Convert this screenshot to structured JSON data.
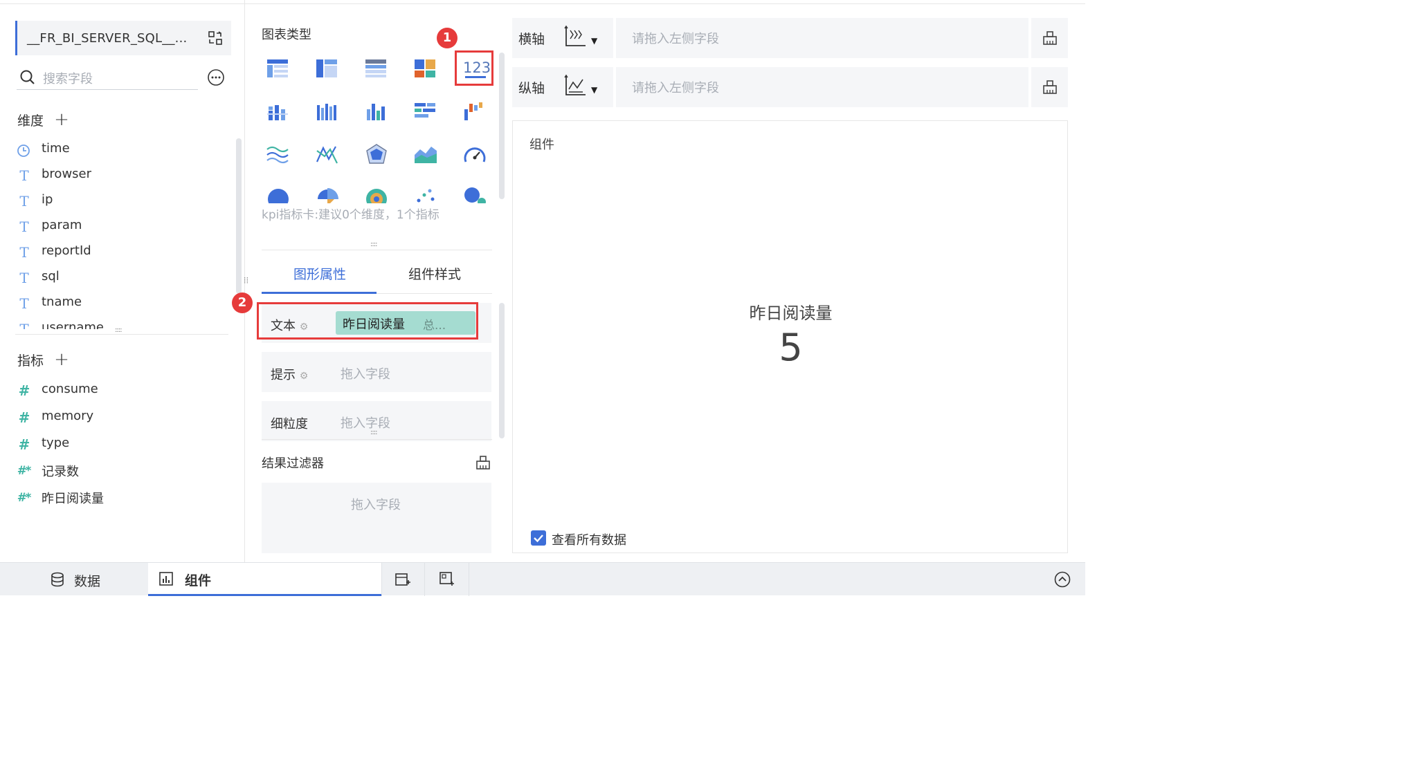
{
  "dataset": {
    "name": "__FR_BI_SERVER_SQL__..."
  },
  "search": {
    "placeholder": "搜索字段"
  },
  "dimensions": {
    "title": "维度",
    "items": [
      {
        "name": "time",
        "type": "date"
      },
      {
        "name": "browser",
        "type": "text"
      },
      {
        "name": "ip",
        "type": "text"
      },
      {
        "name": "param",
        "type": "text"
      },
      {
        "name": "reportId",
        "type": "text"
      },
      {
        "name": "sql",
        "type": "text"
      },
      {
        "name": "tname",
        "type": "text"
      },
      {
        "name": "username",
        "type": "text"
      }
    ]
  },
  "measures": {
    "title": "指标",
    "items": [
      {
        "name": "consume",
        "icon": "#"
      },
      {
        "name": "memory",
        "icon": "#"
      },
      {
        "name": "type",
        "icon": "#"
      },
      {
        "name": "记录数",
        "icon": "#*"
      },
      {
        "name": "昨日阅读量",
        "icon": "#*"
      }
    ]
  },
  "chart_types": {
    "title": "图表类型",
    "selected_label": "123",
    "hint": "kpi指标卡:建议0个维度，1个指标",
    "badge1": "1"
  },
  "tabs": {
    "graph_props": "图形属性",
    "widget_style": "组件样式"
  },
  "props": {
    "badge2": "2",
    "text_label": "文本",
    "text_field": "昨日阅读量",
    "text_agg": "总...",
    "tip_label": "提示",
    "tip_placeholder": "拖入字段",
    "granularity_label": "细粒度",
    "granularity_placeholder": "拖入字段"
  },
  "result_filter": {
    "title": "结果过滤器",
    "placeholder": "拖入字段"
  },
  "axes": {
    "x_label": "横轴",
    "y_label": "纵轴",
    "placeholder": "请拖入左侧字段"
  },
  "preview": {
    "title": "组件",
    "kpi_title": "昨日阅读量",
    "kpi_value": "5",
    "view_all": "查看所有数据"
  },
  "bottom_tabs": {
    "data": "数据",
    "widget": "组件"
  },
  "colors": {
    "accent": "#3d6ed8",
    "highlight": "#e63b3b",
    "pill": "#a5dcd1"
  }
}
